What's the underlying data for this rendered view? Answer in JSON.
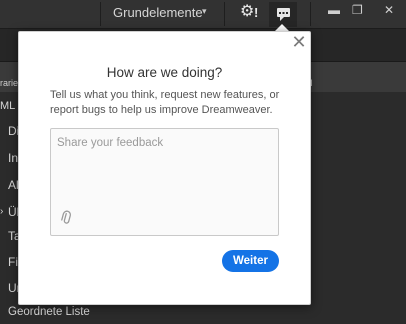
{
  "topbar": {
    "workspace_label": "Grundelemente",
    "workspace_caret": "▾",
    "settings_icon": "⚙",
    "settings_alert": "!",
    "minimize_glyph": "▬",
    "restore_glyph": "❐",
    "close_glyph": "✕"
  },
  "panel": {
    "tab_fragment": "rarie",
    "tab_fragment_right": "H",
    "ml_label": "ML",
    "items": [
      "Di",
      "In",
      "Al",
      "Üb",
      "Ta",
      "Fi",
      "Ur"
    ],
    "bottom_item": "Geordnete Liste"
  },
  "feedback_popup": {
    "close_glyph": "✕",
    "title": "How are we doing?",
    "description": "Tell us what you think, request new features, or report bugs to help us improve Dreamweaver.",
    "placeholder": "Share your feedback",
    "attach_icon": "📎",
    "submit_label": "Weiter"
  },
  "colors": {
    "accent": "#1473e6",
    "dark_bg": "#2b2b2b"
  }
}
